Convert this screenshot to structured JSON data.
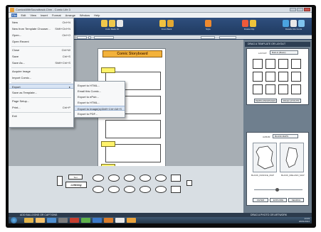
{
  "window": {
    "title": "ComicsWithSoundtrack.Cbm - Comic Life 3"
  },
  "menubar": [
    "File",
    "Edit",
    "View",
    "Insert",
    "Format",
    "Arrange",
    "Window",
    "Help"
  ],
  "toolbar": {
    "groups": [
      {
        "label": "Undo  Redo  Fit",
        "colors": [
          "#f0c84a",
          "#f0c84a",
          "#e8e8e8"
        ]
      },
      {
        "label": "Front  Back",
        "colors": [
          "#f2c23f",
          "#e2a832"
        ]
      },
      {
        "label": "Style",
        "colors": [
          "#ef8a2e"
        ]
      },
      {
        "label": "Rotate  Flip",
        "colors": [
          "#ef5a3a",
          "#efc43a"
        ]
      },
      {
        "label": "Details  Info  Fonts",
        "colors": [
          "#4aa3e0",
          "#e8e8e8",
          "#7fc3ee"
        ]
      }
    ]
  },
  "file_menu": [
    {
      "label": "New",
      "shortcut": "Ctrl+N"
    },
    {
      "label": "New from Template Chooser...",
      "shortcut": "Shift+Ctrl+N"
    },
    {
      "label": "Open...",
      "shortcut": "Ctrl+O"
    },
    {
      "label": "Open Recent",
      "shortcut": ""
    },
    {
      "label": "Close",
      "shortcut": "Ctrl+W"
    },
    {
      "label": "Save",
      "shortcut": "Ctrl+S"
    },
    {
      "label": "Save As...",
      "shortcut": "Shift+Ctrl+S"
    },
    {
      "label": "Acquire Image",
      "shortcut": ""
    },
    {
      "label": "Import Comic...",
      "shortcut": ""
    },
    {
      "label": "Export",
      "shortcut": "▸"
    },
    {
      "label": "Save as Template...",
      "shortcut": ""
    },
    {
      "label": "Page Setup...",
      "shortcut": ""
    },
    {
      "label": "Print...",
      "shortcut": "Ctrl+P"
    },
    {
      "label": "Exit",
      "shortcut": ""
    }
  ],
  "export_submenu": [
    {
      "label": "Export to HTML...",
      "shortcut": ""
    },
    {
      "label": "Email this Comic...",
      "shortcut": ""
    },
    {
      "label": "Export to ePub...",
      "shortcut": ""
    },
    {
      "label": "Export to HTML...",
      "shortcut": ""
    },
    {
      "label": "Export to Image(s)...",
      "shortcut": "Shift+Ctrl+Alt+S"
    },
    {
      "label": "Export to PDF...",
      "shortcut": ""
    }
  ],
  "page": {
    "title": "Comic Storyboard"
  },
  "right_panel": {
    "header1": "DRAG A TEMPLATE OR LAYOUT",
    "layout_label": "LAYOUT",
    "layout_value": "Built-In (Basic)",
    "btn_templates": "TEMPLATES/PAGES",
    "btn_page_layouts": "PAGE LAYOUTS",
    "album_label": "ALBUM",
    "album_value": "BLANK MAPS",
    "tile1_label": "BLANK_FRANCE_MAP",
    "tile2_label": "BLANK_IRELAND_MAP",
    "btn_filter": "FILTER",
    "btn_explore": "EXPLORE",
    "btn_search": "SEARCH",
    "footer": "DRAG A PHOTO OR ARTWORK"
  },
  "balloon_bar": {
    "chip1": "Text",
    "chip2": "Lettering",
    "status": "ADD BALLOONS OR CAPTIONS"
  },
  "taskbar": {
    "apps": [
      "#e3b54a",
      "#f5c26b",
      "#4f8fd0",
      "#7b7b7b",
      "#c63e2e",
      "#5fb14a",
      "#3b78c7",
      "#d97c2b",
      "#e8e8e8",
      "#e9a23b"
    ],
    "time": "14:23",
    "date": "20/01/2014"
  }
}
